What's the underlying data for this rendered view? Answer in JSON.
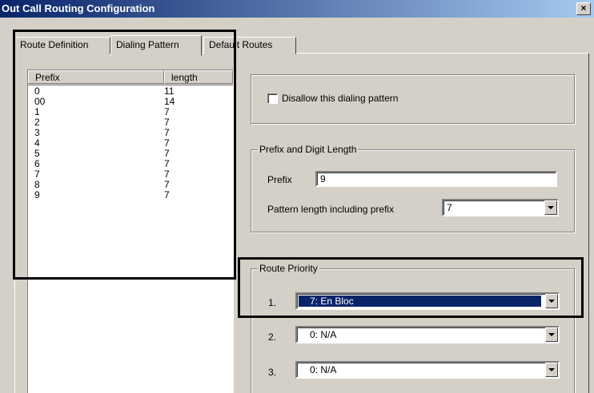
{
  "window": {
    "title": "Out Call Routing Configuration",
    "close_label": "×"
  },
  "tabs": [
    {
      "label": "Route Definition"
    },
    {
      "label": "Dialing Pattern"
    },
    {
      "label": "Default Routes"
    }
  ],
  "list": {
    "headers": [
      "Prefix",
      "length"
    ],
    "rows": [
      [
        "0",
        "11"
      ],
      [
        "00",
        "14"
      ],
      [
        "1",
        "7"
      ],
      [
        "2",
        "7"
      ],
      [
        "3",
        "7"
      ],
      [
        "4",
        "7"
      ],
      [
        "5",
        "7"
      ],
      [
        "6",
        "7"
      ],
      [
        "7",
        "7"
      ],
      [
        "8",
        "7"
      ],
      [
        "9",
        "7"
      ]
    ]
  },
  "disallow": {
    "label": "Disallow this dialing pattern",
    "checked": false
  },
  "prefix_group": {
    "legend": "Prefix and Digit Length",
    "prefix_label": "Prefix",
    "prefix_value": "9",
    "length_label": "Pattern length including prefix",
    "length_value": "7"
  },
  "route_priority": {
    "legend": "Route Priority",
    "items": [
      {
        "num": "1.",
        "value": "7: En Bloc"
      },
      {
        "num": "2.",
        "value": "0: N/A"
      },
      {
        "num": "3.",
        "value": "0: N/A"
      }
    ]
  }
}
